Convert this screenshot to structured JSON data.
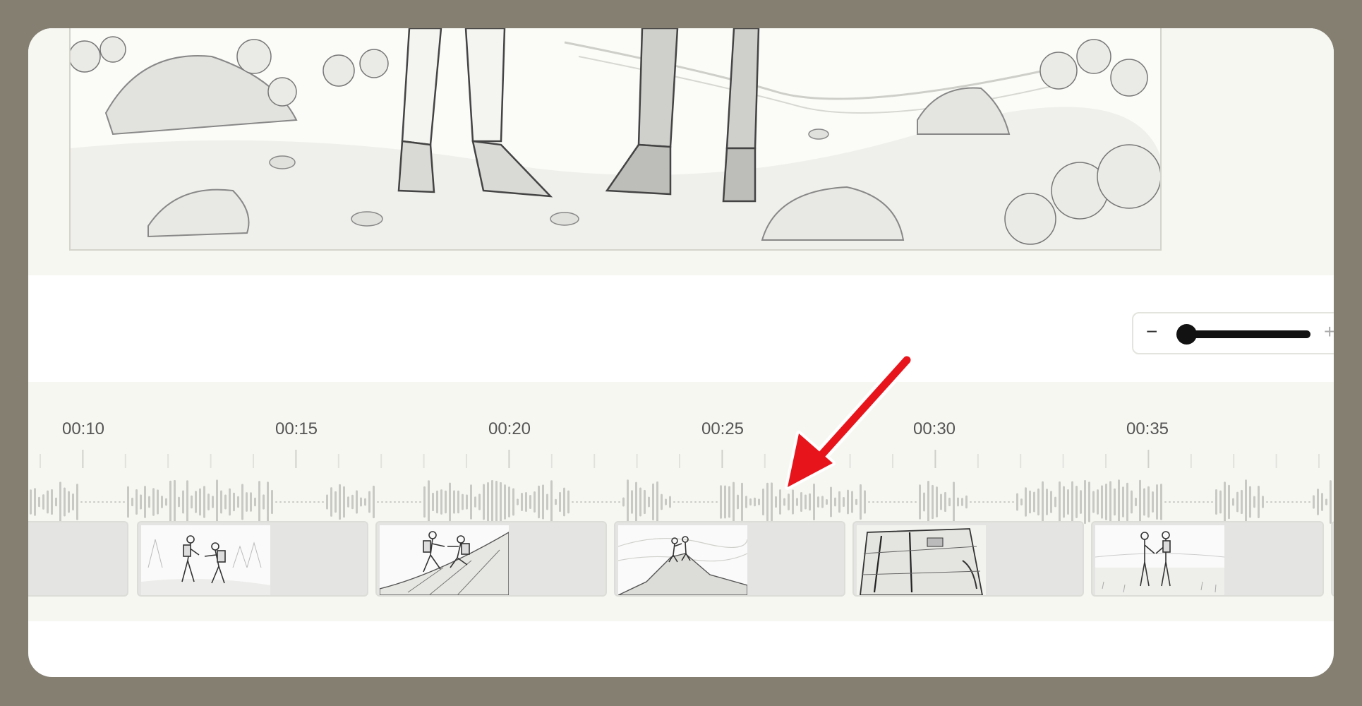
{
  "preview": {
    "description_icon": "storyboard-sketch-hikers-on-trail"
  },
  "zoom": {
    "minus_label": "−",
    "plus_label": "+",
    "level": 0.03
  },
  "timeline": {
    "ruler_labels": [
      "00:10",
      "00:15",
      "00:20",
      "00:25",
      "00:30",
      "00:35"
    ],
    "clips": [
      {
        "name": "clip-1",
        "thumb_icon": ""
      },
      {
        "name": "clip-2",
        "thumb_icon": "hikers-helping-sketch"
      },
      {
        "name": "clip-3",
        "thumb_icon": "hikers-climbing-slope-sketch"
      },
      {
        "name": "clip-4",
        "thumb_icon": "hikers-on-summit-sketch"
      },
      {
        "name": "clip-5",
        "thumb_icon": "backpack-closeup-sketch"
      },
      {
        "name": "clip-6",
        "thumb_icon": "hikers-in-meadow-sketch"
      }
    ]
  },
  "annotation": {
    "arrow_icon": "red-arrow-icon",
    "arrow_color": "#e8141b"
  },
  "colors": {
    "frame_bg": "#857f72",
    "panel_bg": "#f7f7f2",
    "waveform": "#c8c8c4",
    "clip_bg": "#e4e4e2"
  }
}
